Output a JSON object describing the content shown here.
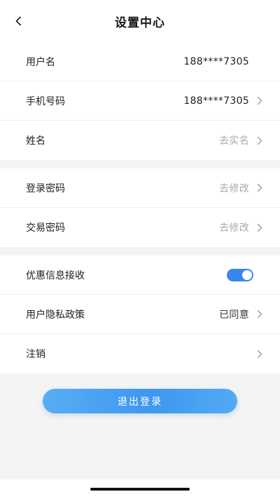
{
  "header": {
    "title": "设置中心",
    "back_icon": "chevron-left-icon"
  },
  "account": {
    "username_label": "用户名",
    "username_value": "188****7305",
    "phone_label": "手机号码",
    "phone_value": "188****7305",
    "name_label": "姓名",
    "name_value": "去实名"
  },
  "security": {
    "login_password_label": "登录密码",
    "login_password_value": "去修改",
    "trade_password_label": "交易密码",
    "trade_password_value": "去修改"
  },
  "settings": {
    "promo_label": "优惠信息接收",
    "promo_enabled": true,
    "privacy_label": "用户隐私政策",
    "privacy_value": "已同意",
    "cancel_label": "注销"
  },
  "actions": {
    "logout_label": "退出登录"
  },
  "colors": {
    "accent": "#3a86ec",
    "button_gradient_start": "#58aef3",
    "button_gradient_end": "#3f97f0",
    "muted_text": "#a9a9a9",
    "background": "#f4f4f4"
  }
}
